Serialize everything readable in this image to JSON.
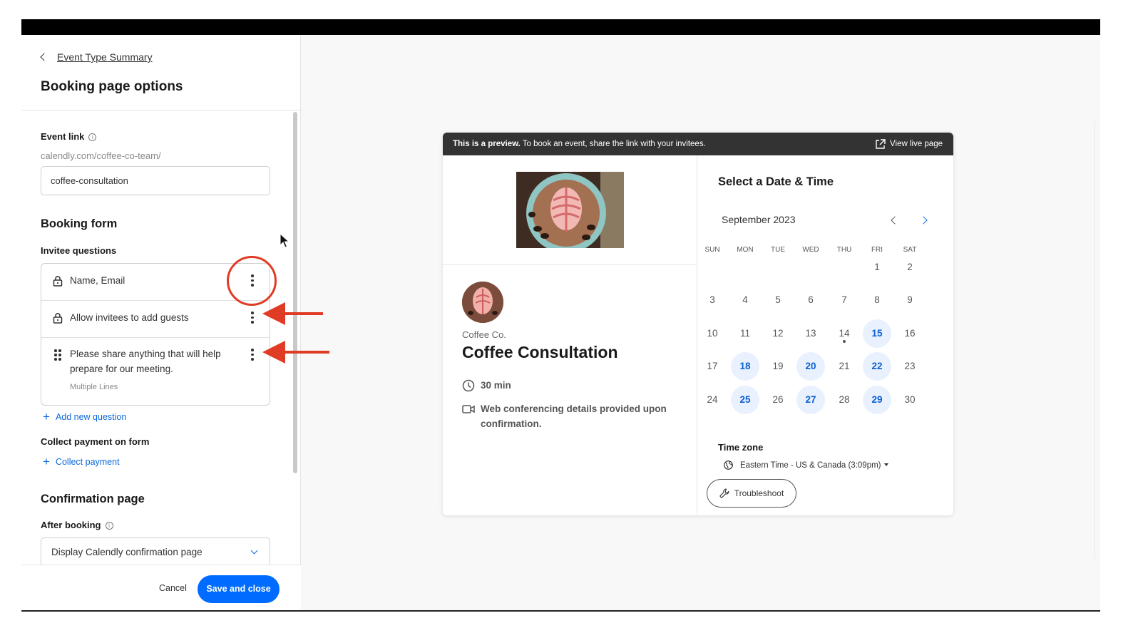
{
  "header": {
    "back_link": "Event Type Summary",
    "title": "Booking page options"
  },
  "event_link": {
    "label": "Event link",
    "prefix": "calendly.com/coffee-co-team/",
    "value": "coffee-consultation"
  },
  "booking_form": {
    "title": "Booking form",
    "questions_label": "Invitee questions",
    "questions": [
      {
        "text": "Name, Email",
        "icon": "lock-icon"
      },
      {
        "text": "Allow invitees to add guests",
        "icon": "lock-icon"
      },
      {
        "text": "Please share anything that will help prepare for our meeting.",
        "sub": "Multiple Lines",
        "icon": "drag-handle-icon"
      }
    ],
    "add_question": "Add new question",
    "payment_label": "Collect payment on form",
    "collect_payment": "Collect payment"
  },
  "confirmation": {
    "title": "Confirmation page",
    "after_label": "After booking",
    "after_value": "Display Calendly confirmation page"
  },
  "footer": {
    "cancel": "Cancel",
    "save": "Save and close"
  },
  "preview": {
    "bar_bold": "This is a preview.",
    "bar_text": " To book an event, share the link with your invitees.",
    "view_live": "View live page",
    "company": "Coffee Co.",
    "event_title": "Coffee Consultation",
    "duration": "30 min",
    "location": "Web conferencing details provided upon confirmation.",
    "select_title": "Select a Date & Time",
    "month": "September 2023",
    "weekdays": [
      "SUN",
      "MON",
      "TUE",
      "WED",
      "THU",
      "FRI",
      "SAT"
    ],
    "first_weekday_index": 5,
    "days_in_month": 30,
    "available_days": [
      15,
      18,
      20,
      22,
      25,
      27,
      29
    ],
    "today": 14,
    "timezone_label": "Time zone",
    "timezone": "Eastern Time - US & Canada (3:09pm)",
    "troubleshoot": "Troubleshoot"
  },
  "colors": {
    "accent": "#006bff",
    "annotation": "#e03b24",
    "available_bg": "#e8f1fd"
  }
}
